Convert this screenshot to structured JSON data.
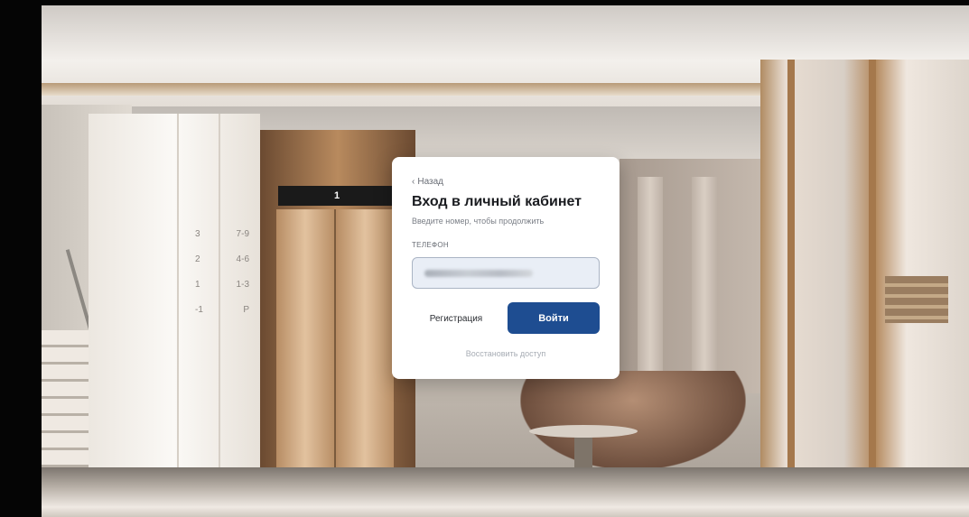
{
  "scene": {
    "elevator_floor": "1",
    "floor_directory": [
      {
        "floor": "3",
        "units": "7-9"
      },
      {
        "floor": "2",
        "units": "4-6"
      },
      {
        "floor": "1",
        "units": "1-3"
      },
      {
        "floor": "-1",
        "units": "P"
      }
    ]
  },
  "login": {
    "back_icon": "chevron-left-icon",
    "back_label": "Назад",
    "title": "Вход в личный кабинет",
    "subtitle": "Введите номер, чтобы продолжить",
    "phone_label": "ТЕЛЕФОН",
    "register_label": "Регистрация",
    "login_label": "Войти",
    "restore_label": "Восстановить доступ",
    "accent_color": "#1e4d91"
  }
}
